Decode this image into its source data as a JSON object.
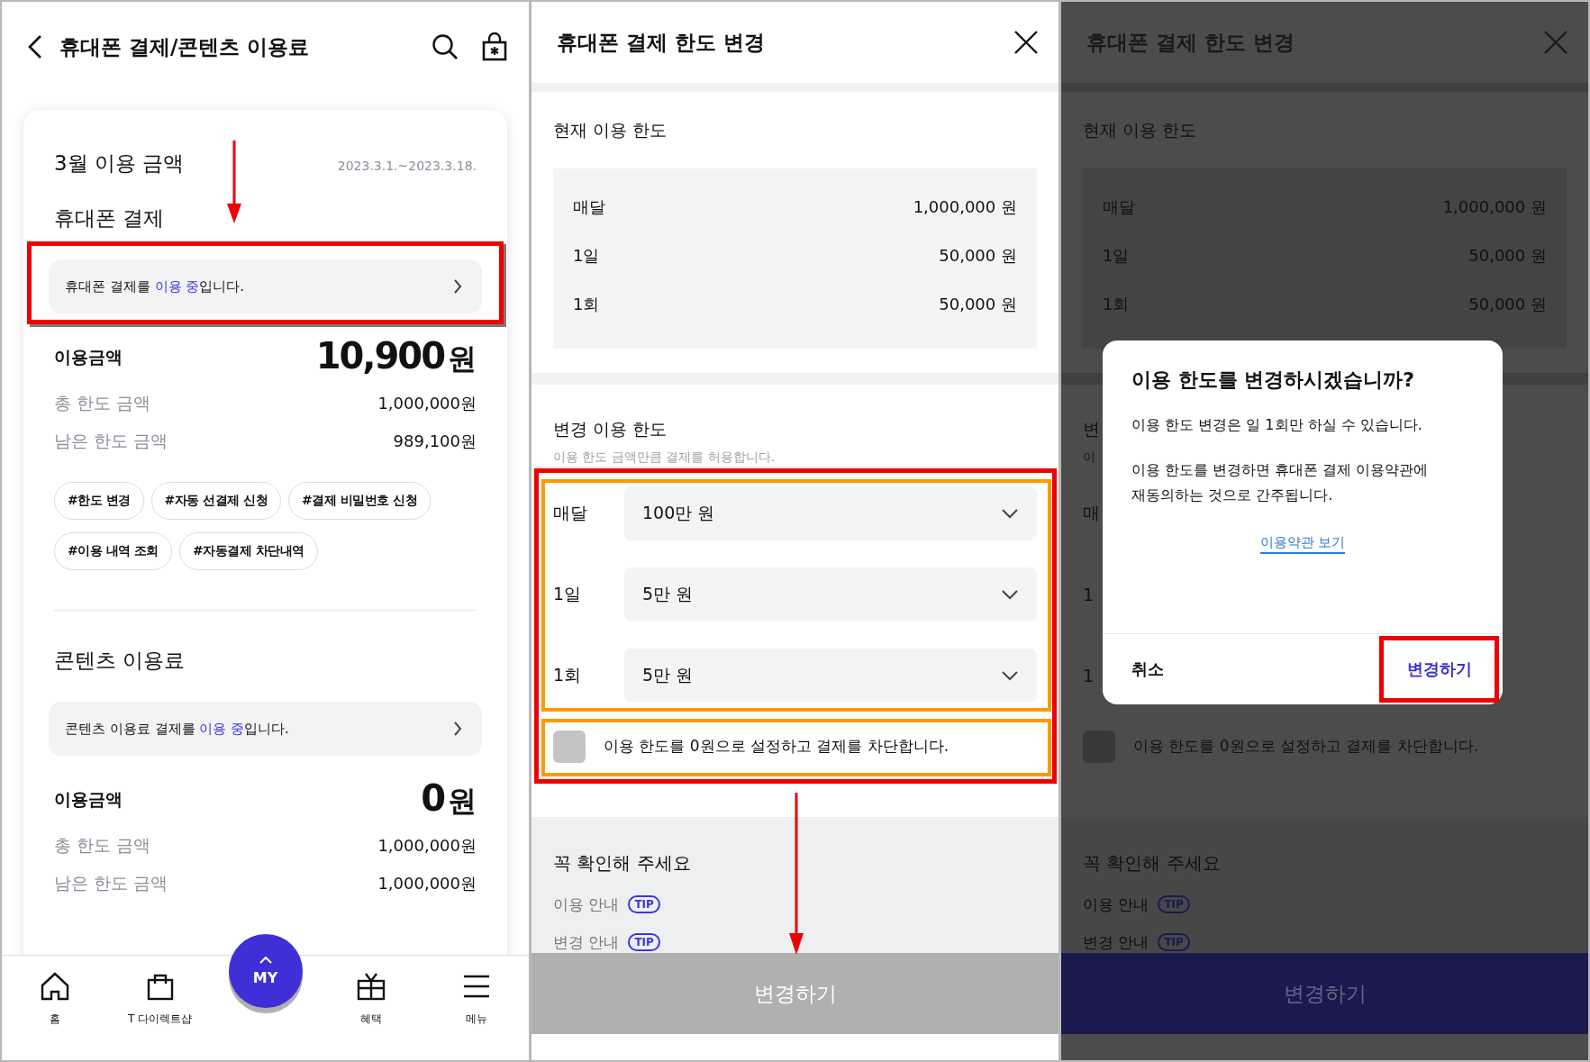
{
  "usage_screen": {
    "title": "휴대폰 결제/콘텐츠 이용료",
    "card": {
      "month_heading": "3월 이용 금액",
      "period": "2023.3.1.~2023.3.18.",
      "sections": [
        {
          "heading": "휴대폰 결제",
          "status": {
            "before": "휴대폰 결제를 ",
            "highlight": "이용 중",
            "after": "입니다.",
            "highlighted": true
          },
          "amount_label": "이용금액",
          "amount": "10,900",
          "unit": "원",
          "rows": [
            {
              "label": "총 한도 금액",
              "value": "1,000,000원"
            },
            {
              "label": "남은 한도 금액",
              "value": "989,100원"
            }
          ],
          "tags": [
            "#한도 변경",
            "#자동 선결제 신청",
            "#결제 비밀번호 신청",
            "#이용 내역 조회",
            "#자동결제 차단내역"
          ]
        },
        {
          "heading": "콘텐츠 이용료",
          "status": {
            "before": "콘텐츠 이용료 결제를 ",
            "highlight": "이용 중",
            "after": "입니다."
          },
          "amount_label": "이용금액",
          "amount": "0",
          "unit": "원",
          "rows": [
            {
              "label": "총 한도 금액",
              "value": "1,000,000원"
            },
            {
              "label": "남은 한도 금액",
              "value": "1,000,000원"
            }
          ]
        }
      ]
    },
    "nav": {
      "items": [
        {
          "label": "홈",
          "kind": "home"
        },
        {
          "label": "T 다이렉트샵",
          "kind": "shop"
        },
        {
          "label": "혜택",
          "kind": "gift"
        },
        {
          "label": "메뉴",
          "kind": "menu"
        }
      ],
      "center": {
        "label": "MY"
      }
    }
  },
  "limit_screen": {
    "title": "휴대폰 결제 한도 변경",
    "current": {
      "heading": "현재 이용 한도",
      "rows": [
        {
          "label": "매달",
          "value": "1,000,000 원"
        },
        {
          "label": "1일",
          "value": "50,000 원"
        },
        {
          "label": "1회",
          "value": "50,000 원"
        }
      ]
    },
    "change": {
      "heading": "변경 이용 한도",
      "hint": "이용 한도 금액만큼 결제를 허용합니다.",
      "highlighted": true,
      "selects": [
        {
          "label": "매달",
          "value": "100만 원"
        },
        {
          "label": "1일",
          "value": "5만 원"
        },
        {
          "label": "1회",
          "value": "5만 원"
        }
      ],
      "block": {
        "label": "이용 한도를 0원으로 설정하고 결제를 차단합니다.",
        "checked": false
      }
    },
    "notice": {
      "heading": "꼭 확인해 주세요",
      "items": [
        {
          "label": "이용 안내",
          "badge": "TIP"
        },
        {
          "label": "변경 안내",
          "badge": "TIP"
        }
      ]
    },
    "submit": {
      "label": "변경하기",
      "disabled": true
    }
  },
  "confirm_screen": {
    "title": "휴대폰 결제 한도 변경",
    "current": {
      "heading": "현재 이용 한도",
      "rows": [
        {
          "label": "매달",
          "value": "1,000,000 원"
        },
        {
          "label": "1일",
          "value": "50,000 원"
        },
        {
          "label": "1회",
          "value": "50,000 원"
        }
      ]
    },
    "change": {
      "heading": "변",
      "hint": "이",
      "selects": [
        {
          "label": "매"
        },
        {
          "label": "1"
        },
        {
          "label": "1"
        }
      ],
      "block": {
        "label": "이용 한도를 0원으로 설정하고 결제를 차단합니다.",
        "checked": false
      }
    },
    "notice": {
      "heading": "꼭 확인해 주세요",
      "items": [
        {
          "label": "이용 안내",
          "badge": "TIP"
        },
        {
          "label": "변경 안내",
          "badge": "TIP"
        }
      ]
    },
    "submit": {
      "label": "변경하기",
      "disabled": false
    },
    "dialog": {
      "title": "이용 한도를 변경하시겠습니까?",
      "paragraphs": [
        [
          "이용 한도 변경은 일 1회만 하실 수 있습니다."
        ],
        [
          "이용 한도를 변경하면 휴대폰 결제 이용약관에",
          "재동의하는 것으로 간주됩니다."
        ]
      ],
      "link": "이용약관 보기",
      "cancel": "취소",
      "confirm": {
        "label": "변경하기",
        "highlighted": true
      }
    }
  }
}
